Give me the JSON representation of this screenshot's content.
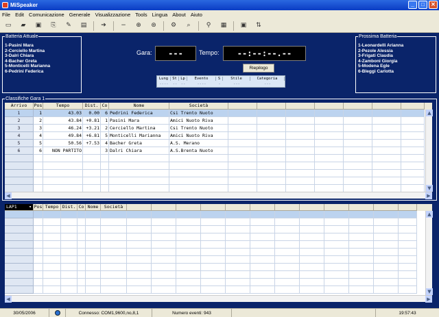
{
  "window": {
    "title": "MiSpeaker",
    "minimize": "_",
    "maximize": "□",
    "close": "✕"
  },
  "menu": [
    "File",
    "Edit",
    "Comunicazione",
    "Generale",
    "Visualizzazione",
    "Tools",
    "Lingua",
    "About",
    "Aiuto"
  ],
  "toolbar": {
    "icons": [
      "new-file-icon",
      "open-folder-icon",
      "save-icon",
      "print-setup-icon",
      "tools-icon",
      "document-icon",
      "export-icon",
      "minus-icon",
      "target-icon",
      "crosshair-icon",
      "gear-icon",
      "search-doc-icon",
      "binoculars-icon",
      "preview-icon",
      "monitor-icon",
      "sort-icon"
    ],
    "glyphs": [
      "▭",
      "▰",
      "▣",
      "⎘",
      "✎",
      "▤",
      "➔",
      "−",
      "⊕",
      "⊛",
      "⚙",
      "⌕",
      "⚲",
      "▦",
      "▣",
      "⇅"
    ]
  },
  "batteria_attuale": {
    "title": "Batteria Attuale",
    "items": [
      "1-Pasini Mara",
      "2-Cerciello Martina",
      "3-Dalri Chiara",
      "4-Bacher Greta",
      "5-Monticelli Marianna",
      "6-Pedrini Federica"
    ]
  },
  "prossima_batteria": {
    "title": "Prossima Batteria",
    "items": [
      "1-Leonardelli Arianna",
      "2-Pezole Alessia",
      "3-Frigati Claudia",
      "4-Zamboni Giorgia",
      "5-Modena Egle",
      "6-Bleggi Carlotta"
    ]
  },
  "gara": {
    "label": "Gara:",
    "value": "---"
  },
  "tempo": {
    "label": "Tempo:",
    "value": "--:--:--.--"
  },
  "riepilogo_button": "Riepilogo",
  "event_table": {
    "headers": [
      "Lung",
      "St",
      "Lp",
      "Evento",
      "S",
      "Stile",
      "Categoria"
    ],
    "row": [
      "----",
      "--",
      "--",
      "----",
      "-",
      "---",
      "---"
    ]
  },
  "classifiche": {
    "title": "Classifiche Gara 1",
    "headers": [
      "Arrivo",
      "Pos",
      "Tempo",
      "Dist.",
      "Co",
      "Nome",
      "Società"
    ],
    "rows": [
      {
        "arrivo": "1",
        "pos": "1",
        "tempo": "43.03",
        "dist": "0.00",
        "co": "6",
        "nome": "Pedrini Federica",
        "societa": "Csi Trento Nuoto"
      },
      {
        "arrivo": "2",
        "pos": "2",
        "tempo": "43.84",
        "dist": "+0.81",
        "co": "1",
        "nome": "Pasini Mara",
        "societa": "Amici Nuoto  Riva"
      },
      {
        "arrivo": "3",
        "pos": "3",
        "tempo": "46.24",
        "dist": "+3.21",
        "co": "2",
        "nome": "Cerciello Martina",
        "societa": "Csi Trento Nuoto"
      },
      {
        "arrivo": "4",
        "pos": "4",
        "tempo": "49.84",
        "dist": "+6.81",
        "co": "5",
        "nome": "Monticelli Marianna",
        "societa": "Amici Nuoto  Riva"
      },
      {
        "arrivo": "5",
        "pos": "5",
        "tempo": "50.56",
        "dist": "+7.53",
        "co": "4",
        "nome": "Bacher Greta",
        "societa": "A.S. Merano"
      },
      {
        "arrivo": "6",
        "pos": "6",
        "tempo": "NON PARTITO",
        "dist": "",
        "co": "3",
        "nome": "Dalri Chiara",
        "societa": "A.S.Brenta Nuoto"
      }
    ]
  },
  "lap": {
    "selector": "LAP1",
    "headers": [
      "Pos",
      "Tempo",
      "Dist.",
      "Co",
      "Nome",
      "Società"
    ]
  },
  "status": {
    "date": "30/05/2006",
    "connection": "Connesso: COM1,9600,no,8,1",
    "events": "Numero eventi: 943",
    "time": "19:57:43"
  },
  "colors": {
    "background": "#0a246a",
    "selected_row": "#bcd3ef",
    "grid_line": "#c8d4e6"
  }
}
